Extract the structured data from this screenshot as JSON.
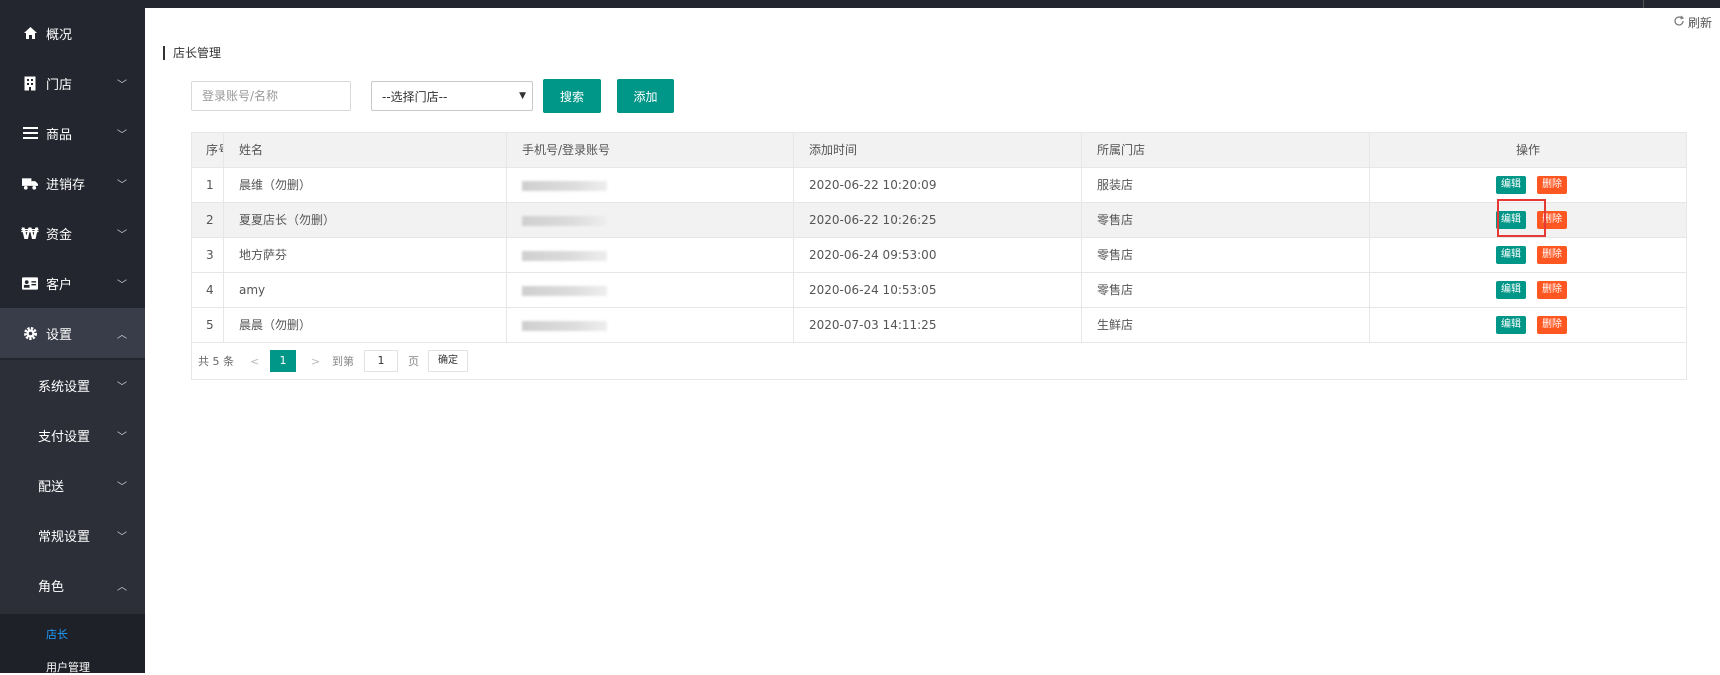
{
  "refresh_label": "刷新",
  "sidebar": {
    "items": [
      {
        "label": "概况",
        "icon": "home-icon"
      },
      {
        "label": "门店",
        "icon": "store-icon"
      },
      {
        "label": "商品",
        "icon": "list-icon"
      },
      {
        "label": "进销存",
        "icon": "truck-icon"
      },
      {
        "label": "资金",
        "icon": "won-icon"
      },
      {
        "label": "客户",
        "icon": "contact-card-icon"
      },
      {
        "label": "设置",
        "icon": "gear-icon"
      }
    ],
    "sub_items": [
      {
        "label": "系统设置"
      },
      {
        "label": "支付设置"
      },
      {
        "label": "配送"
      },
      {
        "label": "常规设置"
      },
      {
        "label": "角色"
      }
    ],
    "leaf_items": [
      {
        "label": "店长",
        "active": true
      },
      {
        "label": "用户管理",
        "active": false
      }
    ]
  },
  "page_title": "店长管理",
  "search": {
    "placeholder": "登录账号/名称"
  },
  "store_select": {
    "selected": "--选择门店--"
  },
  "buttons": {
    "search": "搜索",
    "add": "添加"
  },
  "table": {
    "columns": [
      "序号",
      "姓名",
      "手机号/登录账号",
      "添加时间",
      "所属门店",
      "操作"
    ],
    "rows": [
      {
        "no": "1",
        "name": "晨维（勿删）",
        "added": "2020-06-22 10:20:09",
        "store": "服装店"
      },
      {
        "no": "2",
        "name": "夏夏店长（勿删）",
        "added": "2020-06-22 10:26:25",
        "store": "零售店"
      },
      {
        "no": "3",
        "name": "地方萨芬",
        "added": "2020-06-24 09:53:00",
        "store": "零售店"
      },
      {
        "no": "4",
        "name": "amy",
        "added": "2020-06-24 10:53:05",
        "store": "零售店"
      },
      {
        "no": "5",
        "name": "晨晨（勿删）",
        "added": "2020-07-03 14:11:25",
        "store": "生鲜店"
      }
    ],
    "edit_label": "编辑",
    "delete_label": "删除"
  },
  "pagination": {
    "total": "共 5 条",
    "current_page": "1",
    "goto_label": "到第",
    "goto_value": "1",
    "page_unit": "页",
    "confirm_label": "确定"
  },
  "colors": {
    "primary": "#009688",
    "danger": "#ff5722",
    "sidebar_bg": "#23262e",
    "highlight_box": "#e53935",
    "active_link": "#1e9fff"
  }
}
